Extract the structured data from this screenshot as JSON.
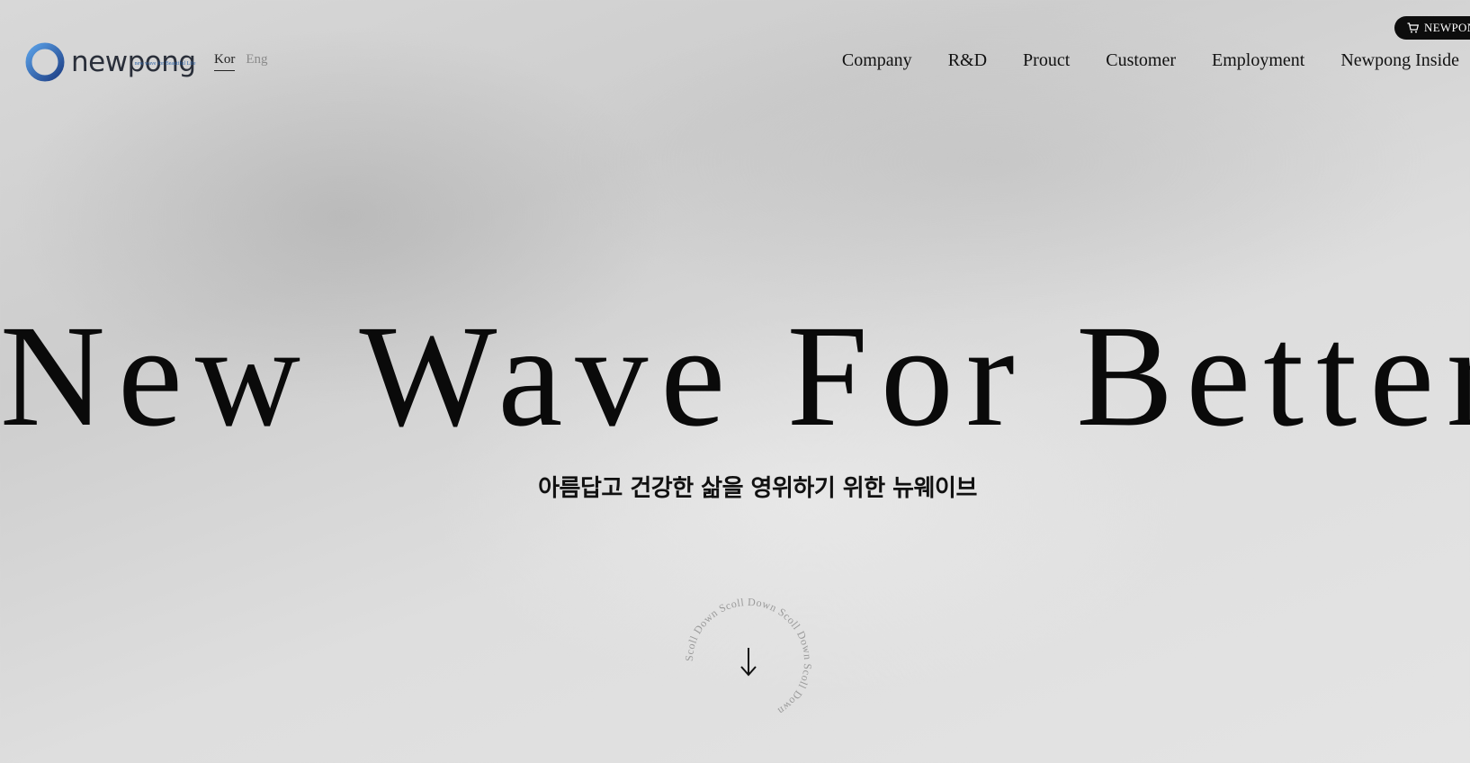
{
  "shop": {
    "label": "NEWPONG SHOP",
    "icon": "cart-icon"
  },
  "logo": {
    "word": "newpong",
    "tagline": "new wave for Beautiful Life"
  },
  "lang": {
    "kor": "Kor",
    "eng": "Eng"
  },
  "nav": [
    "Company",
    "R&D",
    "Prouct",
    "Customer",
    "Employment",
    "Newpong Inside"
  ],
  "hero": {
    "title": "New Wave For Better",
    "subtitle": "아름답고 건강한 삶을 영위하기 위한 뉴웨이브"
  },
  "scroll": {
    "ring_text": "Scoll Down  Scoll Down  Scoll Down  Scoll Down",
    "icon": "arrow-down-icon"
  },
  "colors": {
    "background": "#d6d6d6",
    "text": "#111111",
    "accent": "#2e64a8"
  }
}
